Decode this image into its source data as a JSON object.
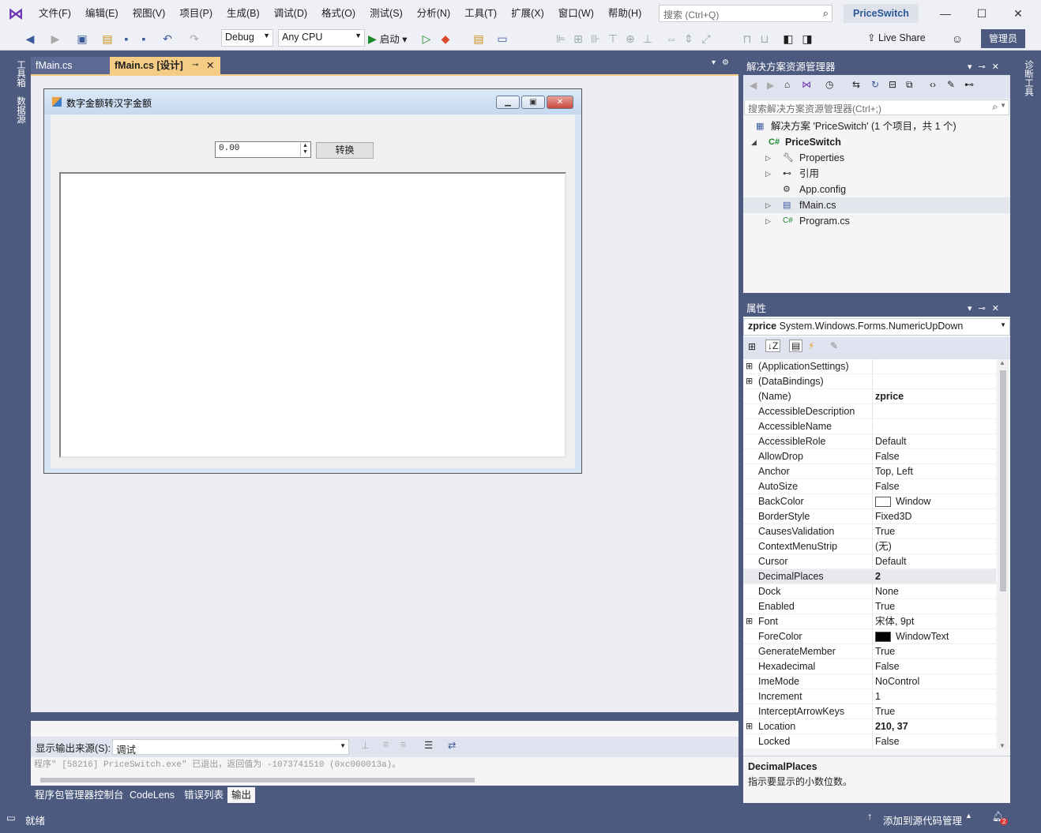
{
  "menu": {
    "items": [
      "文件(F)",
      "编辑(E)",
      "视图(V)",
      "项目(P)",
      "生成(B)",
      "调试(D)",
      "格式(O)",
      "测试(S)",
      "分析(N)",
      "工具(T)",
      "扩展(X)",
      "窗口(W)",
      "帮助(H)"
    ],
    "search_placeholder": "搜索 (Ctrl+Q)",
    "solution_name": "PriceSwitch"
  },
  "toolbar": {
    "config": "Debug",
    "platform": "Any CPU",
    "start_label": "启动",
    "liveshare_label": "Live Share",
    "admin_label": "管理员"
  },
  "left_strip": {
    "toolbox": "工具箱",
    "datasources": "数据源"
  },
  "right_strip": {
    "diagnostics": "诊断工具"
  },
  "doc_tabs": [
    {
      "label": "fMain.cs"
    },
    {
      "label": "fMain.cs [设计]"
    }
  ],
  "form_designer": {
    "title": "数字金额转汉字金额",
    "numeric_value": "0.00",
    "convert_button": "转换"
  },
  "solution_explorer": {
    "title": "解决方案资源管理器",
    "search_placeholder": "搜索解决方案资源管理器(Ctrl+;)",
    "items": [
      {
        "label": "解决方案 'PriceSwitch' (1 个项目，共 1 个)",
        "icon": "solution-icon"
      },
      {
        "label": "PriceSwitch",
        "icon": "csharp-project-icon"
      },
      {
        "label": "Properties",
        "icon": "wrench-icon"
      },
      {
        "label": "引用",
        "icon": "references-icon"
      },
      {
        "label": "App.config",
        "icon": "config-icon"
      },
      {
        "label": "fMain.cs",
        "icon": "form-icon"
      },
      {
        "label": "Program.cs",
        "icon": "csharp-file-icon"
      }
    ]
  },
  "properties": {
    "title": "属性",
    "object_name": "zprice",
    "object_type": "System.Windows.Forms.NumericUpDown",
    "rows": [
      {
        "name": "(ApplicationSettings)",
        "value": "",
        "expandable": true
      },
      {
        "name": "(DataBindings)",
        "value": "",
        "expandable": true
      },
      {
        "name": "(Name)",
        "value": "zprice",
        "bold": true
      },
      {
        "name": "AccessibleDescription",
        "value": ""
      },
      {
        "name": "AccessibleName",
        "value": ""
      },
      {
        "name": "AccessibleRole",
        "value": "Default"
      },
      {
        "name": "AllowDrop",
        "value": "False"
      },
      {
        "name": "Anchor",
        "value": "Top, Left"
      },
      {
        "name": "AutoSize",
        "value": "False"
      },
      {
        "name": "BackColor",
        "value": "Window",
        "swatch": "#ffffff"
      },
      {
        "name": "BorderStyle",
        "value": "Fixed3D"
      },
      {
        "name": "CausesValidation",
        "value": "True"
      },
      {
        "name": "ContextMenuStrip",
        "value": "(无)"
      },
      {
        "name": "Cursor",
        "value": "Default"
      },
      {
        "name": "DecimalPlaces",
        "value": "2",
        "bold": true,
        "selected": true
      },
      {
        "name": "Dock",
        "value": "None"
      },
      {
        "name": "Enabled",
        "value": "True"
      },
      {
        "name": "Font",
        "value": "宋体, 9pt",
        "expandable": true
      },
      {
        "name": "ForeColor",
        "value": "WindowText",
        "swatch": "#000000"
      },
      {
        "name": "GenerateMember",
        "value": "True"
      },
      {
        "name": "Hexadecimal",
        "value": "False"
      },
      {
        "name": "ImeMode",
        "value": "NoControl"
      },
      {
        "name": "Increment",
        "value": "1"
      },
      {
        "name": "InterceptArrowKeys",
        "value": "True"
      },
      {
        "name": "Location",
        "value": "210, 37",
        "bold": true,
        "expandable": true
      },
      {
        "name": "Locked",
        "value": "False"
      }
    ],
    "description_title": "DecimalPlaces",
    "description_text": "指示要显示的小数位数。"
  },
  "output": {
    "title": "输出",
    "source_label": "显示输出来源(S):",
    "source_value": "调试",
    "text": "程序\" [58216] PriceSwitch.exe\" 已退出，返回值为 -1073741510 (0xc000013a)。"
  },
  "bottom_tabs": [
    "程序包管理器控制台",
    "CodeLens",
    "错误列表",
    "输出"
  ],
  "status": {
    "ready": "就绪",
    "source_control": "添加到源代码管理",
    "notifications": "2"
  },
  "colors": {
    "chrome": "#4d5a80",
    "active_tab": "#f5cc84",
    "accent": "#6b35b5"
  }
}
